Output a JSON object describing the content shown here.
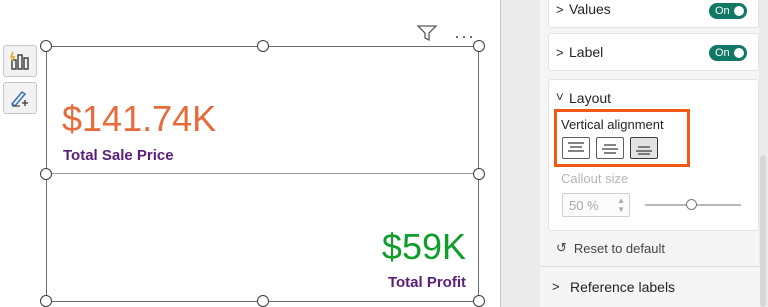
{
  "canvas": {
    "kpi_top": {
      "value": "$141.74K",
      "label": "Total Sale Price",
      "value_color": "#e76b3a"
    },
    "kpi_bottom": {
      "value": "$59K",
      "label": "Total Profit",
      "value_color": "#0f9d2c"
    },
    "label_color": "#5a1f7a",
    "toolbar_icons": [
      "filter-icon",
      "more-options-icon"
    ],
    "left_icons": [
      "build-visual-icon",
      "format-visual-icon"
    ]
  },
  "pane": {
    "values_section": {
      "title": "Values",
      "toggle": "On"
    },
    "label_section": {
      "title": "Label",
      "toggle": "On"
    },
    "layout_section": {
      "title": "Layout",
      "vertical_alignment_label": "Vertical alignment",
      "alignment_options": [
        "top",
        "middle",
        "bottom"
      ],
      "selected_alignment": "bottom",
      "callout_size_label": "Callout size",
      "callout_size_value": "50 %",
      "callout_slider_fraction": 0.5,
      "reset_label": "Reset to default"
    },
    "reference_labels": {
      "title": "Reference labels"
    },
    "toggle_color": "#117865",
    "highlight_color": "#f05a14"
  }
}
